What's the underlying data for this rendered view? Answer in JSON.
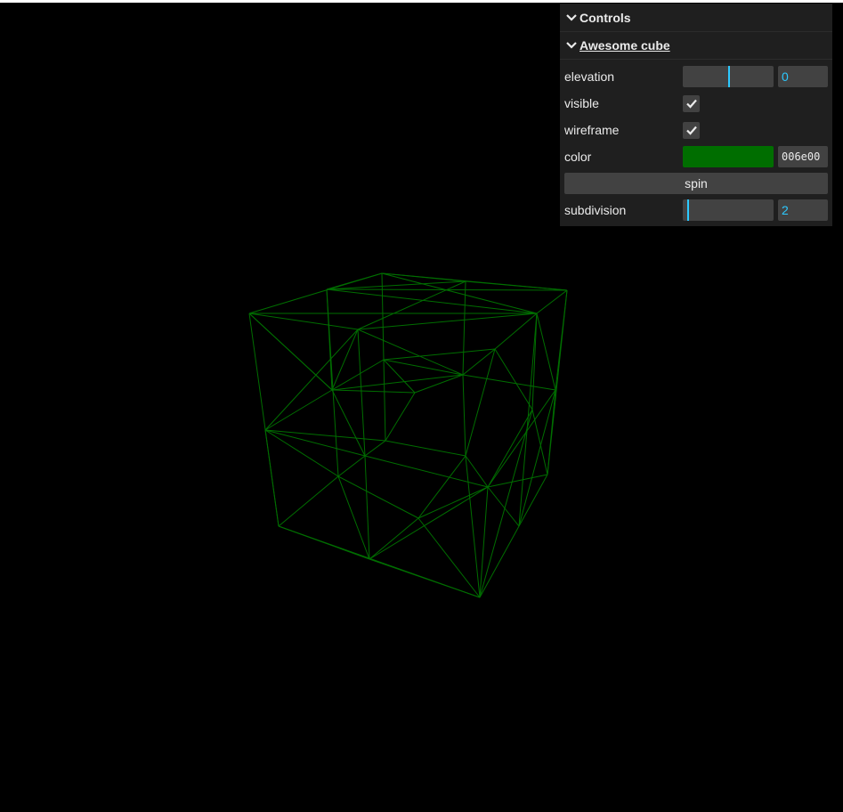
{
  "gui": {
    "title": "Controls",
    "folder": {
      "title": "Awesome cube",
      "elevation": {
        "label": "elevation",
        "value": "0",
        "fraction": 0.5
      },
      "visible": {
        "label": "visible",
        "checked": true
      },
      "wireframe": {
        "label": "wireframe",
        "checked": true
      },
      "color": {
        "label": "color",
        "value": "006e00",
        "swatch": "#006e00"
      },
      "spin": {
        "label": "spin"
      },
      "subdivision": {
        "label": "subdivision",
        "value": "2",
        "fraction": 0.05
      }
    }
  },
  "scene": {
    "background": "#000000",
    "wire_color": "#006e00",
    "accent": "#2cc9ff"
  }
}
